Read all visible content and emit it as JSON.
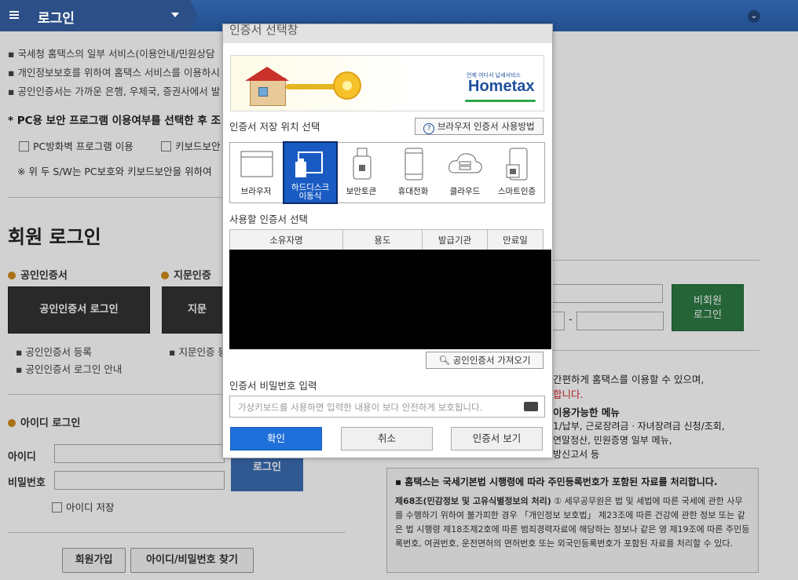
{
  "header": {
    "title": "로그인"
  },
  "notices": [
    "국세청 홈택스의 일부 서비스(이용안내/민원상담",
    "개인정보보호를 위하여 홈택스 서비스를 이용하시",
    "공인인증서는 가까운 은행, 우체국, 증권사에서 발"
  ],
  "security": {
    "heading": "* PC용 보안 프로그램 이용여부를 선택한 후 조",
    "firewall": "PC방화벽 프로그램 이용",
    "keyboard": "키보드보안",
    "note": "※ 위 두 S/W는 PC보호와 키보드보안을 위하여"
  },
  "member": {
    "title": "회원 로그인",
    "cert_section": "공인인증서",
    "bio_section": "지문인증",
    "cert_login": "공인인증서 로그인",
    "bio_login": "지문",
    "cert_links": [
      "공인인증서 등록",
      "공인인증서 로그인 안내"
    ],
    "bio_link": "지문인증 등",
    "id_section": "아이디 로그인",
    "id_label": "아이디",
    "pw_label": "비밀번호",
    "login": "로그인",
    "save_id": "아이디 저장",
    "signup": "회원가입",
    "find": "아이디/비밀번호 찾기"
  },
  "right": {
    "guest_login": "비회원\n로그인",
    "dash": "-",
    "text1": "간편하게 홈택스를 이용할 수 있으며,",
    "text2": "합니다.",
    "menu_title": "이용가능한 메뉴",
    "menu1": "1/납부, 근로장려금ㆍ자녀장려금 신청/조회,",
    "menu2": "연말정산, 민원증명 일부 메뉴,",
    "menu3": "방신고서 등",
    "law_title": "▪ 홈택스는 국세기본법 시행령에 따라 주민등록번호가 포함된 자료를 처리합니다.",
    "law_strong": "제68조(민감정보 및 고유식별정보의 처리)",
    "law_text": "① 세무공무원은 법 및 세법에 따른 국세에 관한 사무를 수행하기 위하여 불가피한 경우 「개인정보 보호법」 제23조에 따른 건강에 관한 정보 또는 같은 법 시행령 제18조제2호에 따른 범죄경력자료에 해당하는 정보나 같은 영 제19조에 따른 주민등록번호, 여권번호, 운전면허의 면허번호 또는 외국인등록번호가 포함된 자료를 처리할 수 있다."
  },
  "modal": {
    "title": "인증서 선택창",
    "banner_logo": "Hometax",
    "banner_sub": "언제 어디서 납세서비스",
    "location_label": "인증서 저장 위치 선택",
    "help": "브라우저 인증서 사용방법",
    "locations": [
      {
        "label": "브라우저",
        "icon": "browser-icon"
      },
      {
        "label": "하드디스크\n이동식",
        "icon": "usb-drive-icon"
      },
      {
        "label": "보안토큰",
        "icon": "security-token-icon"
      },
      {
        "label": "휴대전화",
        "icon": "mobile-phone-icon"
      },
      {
        "label": "클라우드",
        "icon": "cloud-icon"
      },
      {
        "label": "스마트인증",
        "icon": "smart-auth-icon"
      }
    ],
    "cert_label": "사용할 인증서 선택",
    "columns": [
      "소유자명",
      "용도",
      "발급기관",
      "만료일"
    ],
    "import": "공인인증서 가져오기",
    "pw_label": "인증서 비밀번호 입력",
    "pw_placeholder": "가상키보드를 사용하면 입력한 내용이 보다 안전하게 보호됩니다.",
    "ok": "확인",
    "cancel": "취소",
    "view": "인증서 보기"
  }
}
